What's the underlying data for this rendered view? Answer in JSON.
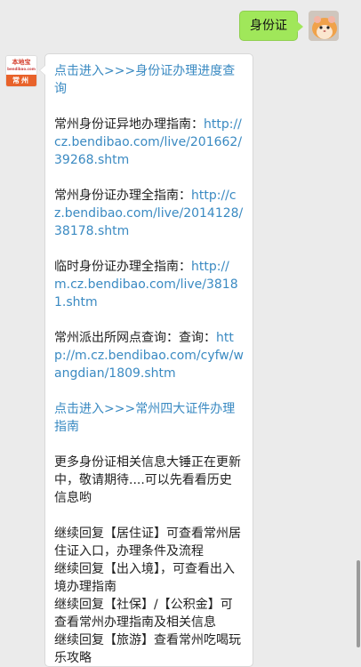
{
  "outgoing": {
    "text": "身份证",
    "avatar_icon": "hamster-avatar-icon"
  },
  "incoming": {
    "avatar": {
      "brand_name": "本地宝",
      "brand_site": "bendibao.com",
      "city": "常州"
    },
    "link_color": "#3a8ac2",
    "blocks": [
      {
        "link": "点击进入>>>身份证办理进度查询"
      },
      {
        "label": "常州身份证异地办理指南：",
        "url": "http://cz.bendibao.com/live/201662/39268.shtm"
      },
      {
        "label": "常州身份证办理全指南：",
        "url": "http://cz.bendibao.com/live/2014128/38178.shtm"
      },
      {
        "label": "临时身份证办理全指南：",
        "url": "http://m.cz.bendibao.com/live/38181.shtm"
      },
      {
        "label": "常州派出所网点查询：查询：",
        "url": "http://m.cz.bendibao.com/cyfw/wangdian/1809.shtm"
      },
      {
        "link": "点击进入>>>常州四大证件办理指南"
      },
      {
        "text": "更多身份证相关信息大锤正在更新中，敬请期待....可以先看看历史信息哟"
      }
    ],
    "replies": [
      "继续回复【居住证】可查看常州居住证入口，办理条件及流程",
      "继续回复【出入境】，可查看出入境办理指南",
      "继续回复【社保】/【公积金】可查看常州办理指南及相关信息",
      "继续回复【旅游】查看常州吃喝玩乐攻略"
    ]
  }
}
